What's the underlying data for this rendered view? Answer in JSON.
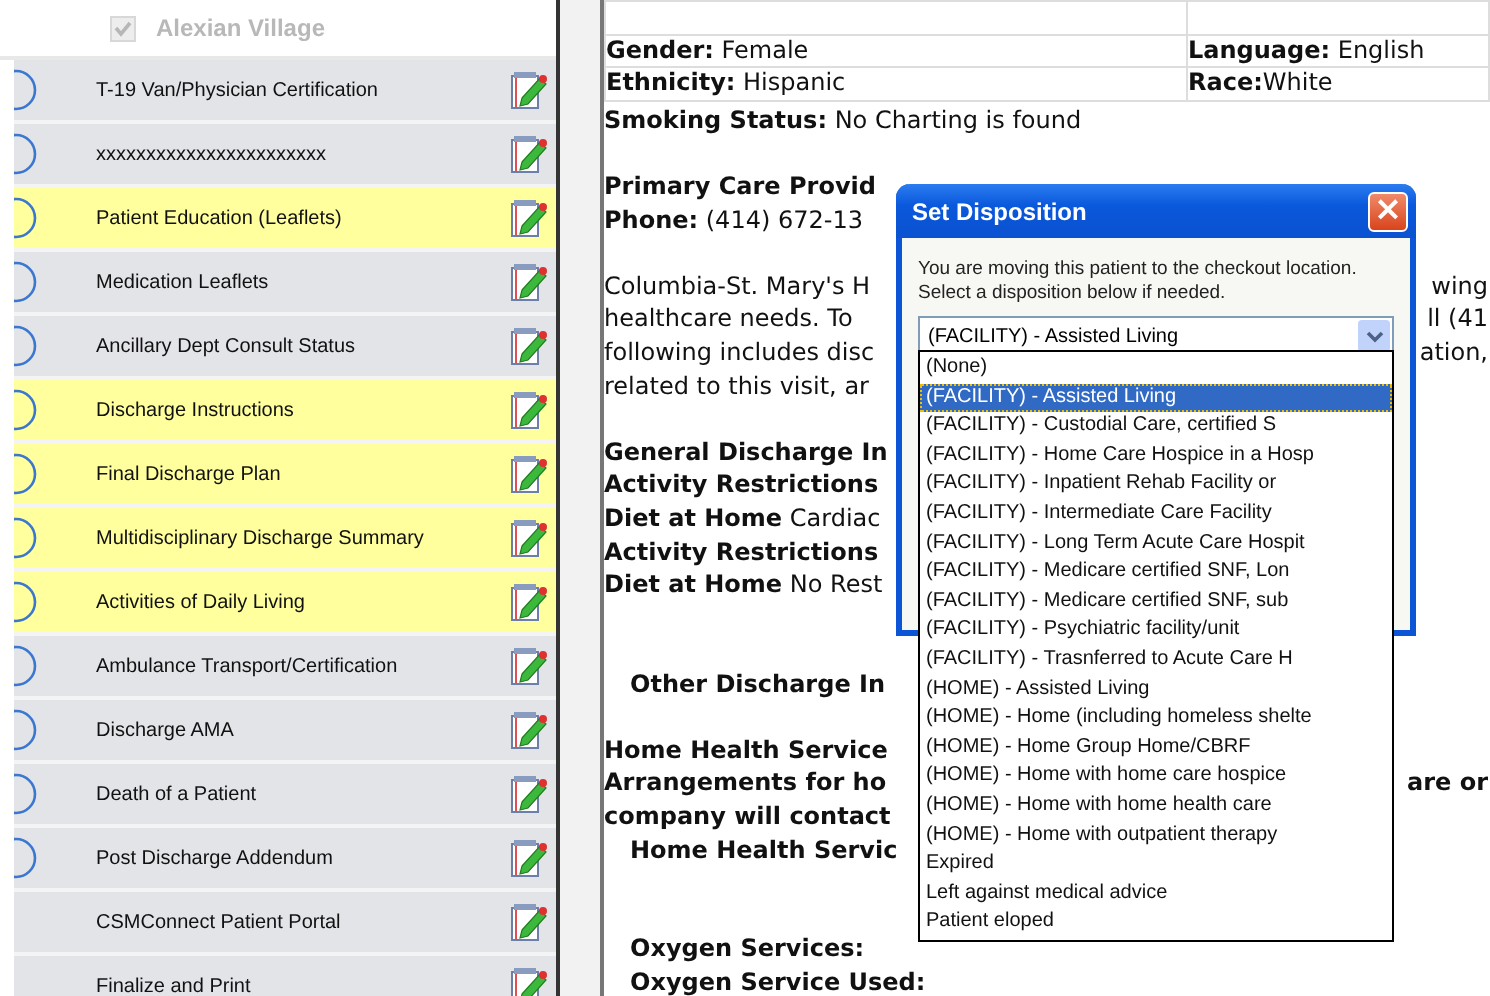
{
  "sidebar": {
    "header": {
      "label": "Alexian Village",
      "checked": true,
      "disabled": true
    },
    "items": [
      {
        "label": "T-19 Van/Physician Certification",
        "highlighted": false,
        "status_circle": true
      },
      {
        "label": "xxxxxxxxxxxxxxxxxxxxxxx",
        "highlighted": false,
        "status_circle": true
      },
      {
        "label": "Patient Education (Leaflets)",
        "highlighted": true,
        "status_circle": true
      },
      {
        "label": "Medication Leaflets",
        "highlighted": false,
        "status_circle": true
      },
      {
        "label": "Ancillary Dept Consult Status",
        "highlighted": false,
        "status_circle": true
      },
      {
        "label": "Discharge Instructions",
        "highlighted": true,
        "status_circle": true
      },
      {
        "label": "Final Discharge Plan",
        "highlighted": true,
        "status_circle": true
      },
      {
        "label": "Multidisciplinary Discharge Summary",
        "highlighted": true,
        "status_circle": true
      },
      {
        "label": "Activities of Daily Living",
        "highlighted": true,
        "status_circle": true
      },
      {
        "label": "Ambulance Transport/Certification",
        "highlighted": false,
        "status_circle": true
      },
      {
        "label": "Discharge AMA",
        "highlighted": false,
        "status_circle": true
      },
      {
        "label": "Death of a Patient",
        "highlighted": false,
        "status_circle": true
      },
      {
        "label": "Post Discharge Addendum",
        "highlighted": false,
        "status_circle": true
      },
      {
        "label": "CSMConnect Patient Portal",
        "highlighted": false,
        "status_circle": false
      },
      {
        "label": "Finalize and Print",
        "highlighted": false,
        "status_circle": false
      }
    ]
  },
  "document": {
    "demographics": [
      {
        "left": "**Gender:**  Female",
        "right": "**Language:** English"
      },
      {
        "left": "**Ethnicity:** Hispanic",
        "right": "**Race:**White"
      }
    ],
    "blocks": [
      {
        "lines": [
          {
            "text": "**Smoking Status:** No Charting is found",
            "indented": false
          }
        ]
      },
      {
        "lines": [
          {
            "text": "**Primary Care Provid**",
            "indented": false
          },
          {
            "text": "**Phone:** (414) 672-13",
            "indented": false
          }
        ]
      },
      {
        "lines": [
          {
            "text": "Columbia-St. Mary's H",
            "right": "wing",
            "indented": false
          },
          {
            "text": "healthcare needs. To",
            "right": "ll (41",
            "indented": false
          },
          {
            "text": "following includes disc",
            "right": "ation,",
            "indented": false
          },
          {
            "text": "related to this visit, ar",
            "indented": false
          }
        ]
      },
      {
        "lines": [
          {
            "text": "**General Discharge In**",
            "indented": false
          },
          {
            "text": "**Activity Restrictions**",
            "indented": false
          },
          {
            "text": "**Diet at Home**  Cardiac",
            "indented": false
          },
          {
            "text": "**Activity Restrictions**",
            "indented": false
          },
          {
            "text": "**Diet at Home**  No Rest",
            "indented": false
          }
        ]
      },
      {
        "lines": [
          {
            "text": "**Other Discharge In**",
            "indented": true
          }
        ]
      },
      {
        "lines": [
          {
            "text": "**Home Health Service**",
            "indented": false
          },
          {
            "text": "**Arrangements for ho**",
            "right": "**are or**",
            "indented": false
          },
          {
            "text": "**company will contact**",
            "indented": false
          },
          {
            "text": "**Home Health Servic**",
            "indented": true
          }
        ]
      },
      {
        "lines": [
          {
            "text": "**Oxygen Services:**",
            "indented": true
          },
          {
            "text": "**Oxygen Service Used:**",
            "indented": true
          }
        ]
      }
    ]
  },
  "dialog": {
    "title": "Set Disposition",
    "close": "×",
    "message": [
      "You are moving this patient to the checkout location.",
      "Select a disposition below if needed."
    ],
    "select_value": "(FACILITY) - Assisted Living",
    "options": [
      {
        "label": "(None)",
        "selected": false
      },
      {
        "label": "(FACILITY) - Assisted Living",
        "selected": true
      },
      {
        "label": "(FACILITY) - Custodial Care, certified S",
        "selected": false
      },
      {
        "label": "(FACILITY) - Home Care Hospice in a Hosp",
        "selected": false
      },
      {
        "label": "(FACILITY) - Inpatient Rehab Facility or",
        "selected": false
      },
      {
        "label": "(FACILITY) - Intermediate Care Facility",
        "selected": false
      },
      {
        "label": "(FACILITY) - Long Term Acute Care Hospit",
        "selected": false
      },
      {
        "label": "(FACILITY) - Medicare certified SNF, Lon",
        "selected": false
      },
      {
        "label": "(FACILITY) - Medicare certified SNF, sub",
        "selected": false
      },
      {
        "label": "(FACILITY) - Psychiatric facility/unit",
        "selected": false
      },
      {
        "label": "(FACILITY) - Trasnferred to Acute Care H",
        "selected": false
      },
      {
        "label": "(HOME) - Assisted Living",
        "selected": false
      },
      {
        "label": "(HOME) - Home (including homeless shelte",
        "selected": false
      },
      {
        "label": "(HOME) - Home Group Home/CBRF",
        "selected": false
      },
      {
        "label": "(HOME) - Home with home care hospice",
        "selected": false
      },
      {
        "label": "(HOME) - Home with home health care",
        "selected": false
      },
      {
        "label": "(HOME) - Home with outpatient therapy",
        "selected": false
      },
      {
        "label": "Expired",
        "selected": false
      },
      {
        "label": "Left against medical advice",
        "selected": false
      },
      {
        "label": "Patient eloped",
        "selected": false
      }
    ]
  }
}
